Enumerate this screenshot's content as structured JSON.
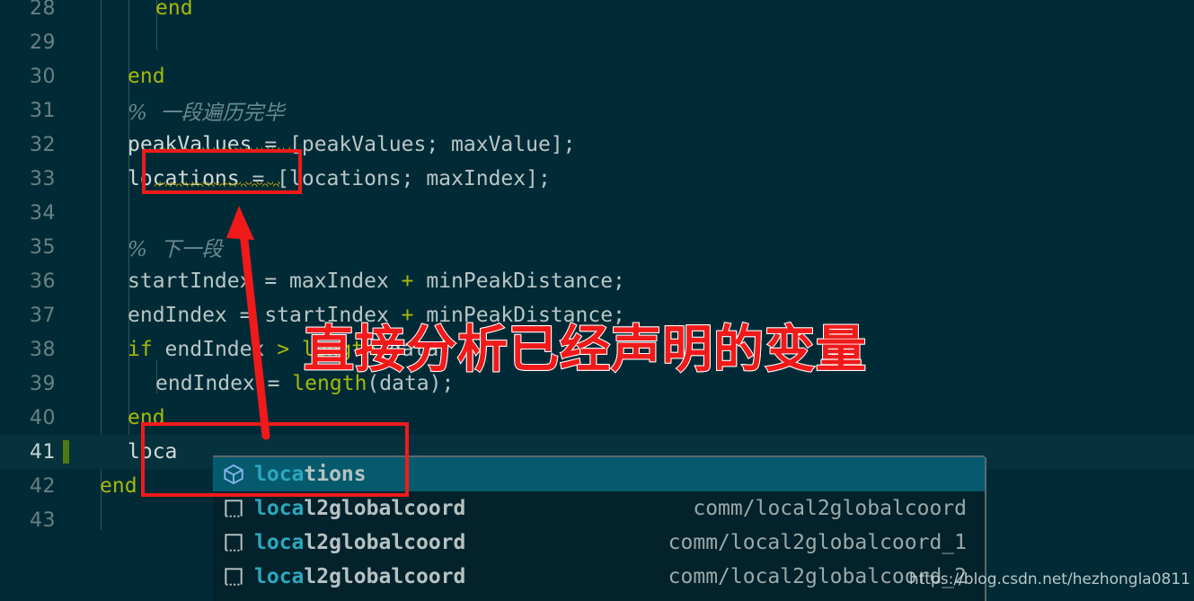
{
  "editor": {
    "background": "#002b36",
    "active_line_background": "#06323d",
    "first_visible_line": 28,
    "cursor_line": 41,
    "lines": [
      {
        "num": "28",
        "indent": 3,
        "tokens": [
          {
            "t": "end",
            "c": "kw"
          }
        ]
      },
      {
        "num": "29",
        "indent": 0,
        "tokens": []
      },
      {
        "num": "30",
        "indent": 2,
        "tokens": [
          {
            "t": "end",
            "c": "kw"
          }
        ]
      },
      {
        "num": "31",
        "indent": 2,
        "tokens": [
          {
            "t": "%  一段遍历完毕",
            "c": "cmt"
          }
        ]
      },
      {
        "num": "32",
        "indent": 2,
        "tokens": [
          {
            "t": "peakValues",
            "c": "id"
          },
          {
            "t": " = [peakValues; maxValue];",
            "c": "op"
          }
        ]
      },
      {
        "num": "33",
        "indent": 2,
        "tokens": [
          {
            "t": "locations",
            "c": "id"
          },
          {
            "t": " = [locations; maxIndex];",
            "c": "op"
          }
        ]
      },
      {
        "num": "34",
        "indent": 0,
        "tokens": []
      },
      {
        "num": "35",
        "indent": 2,
        "tokens": [
          {
            "t": "%  下一段",
            "c": "cmt"
          }
        ]
      },
      {
        "num": "36",
        "indent": 2,
        "tokens": [
          {
            "t": "startIndex = maxIndex ",
            "c": "op"
          },
          {
            "t": "+",
            "c": "opy"
          },
          {
            "t": " minPeakDistance;",
            "c": "op"
          }
        ]
      },
      {
        "num": "37",
        "indent": 2,
        "tokens": [
          {
            "t": "endIndex = startIndex ",
            "c": "op"
          },
          {
            "t": "+",
            "c": "opy"
          },
          {
            "t": " minPeakDistance;",
            "c": "op"
          }
        ]
      },
      {
        "num": "38",
        "indent": 2,
        "tokens": [
          {
            "t": "if",
            "c": "kw"
          },
          {
            "t": " endIndex ",
            "c": "op"
          },
          {
            "t": ">",
            "c": "opy"
          },
          {
            "t": " ",
            "c": "op"
          },
          {
            "t": "length",
            "c": "fn"
          },
          {
            "t": "(data)",
            "c": "op"
          }
        ]
      },
      {
        "num": "39",
        "indent": 3,
        "tokens": [
          {
            "t": "endIndex = ",
            "c": "op"
          },
          {
            "t": "length",
            "c": "fn"
          },
          {
            "t": "(data);",
            "c": "op"
          }
        ]
      },
      {
        "num": "40",
        "indent": 2,
        "tokens": [
          {
            "t": "end",
            "c": "kw"
          }
        ]
      },
      {
        "num": "41",
        "indent": 2,
        "tokens": [
          {
            "t": "loca",
            "c": "id"
          }
        ]
      },
      {
        "num": "42",
        "indent": 1,
        "tokens": [
          {
            "t": "end",
            "c": "kw"
          }
        ]
      },
      {
        "num": "43",
        "indent": 0,
        "tokens": []
      }
    ]
  },
  "suggest": {
    "items": [
      {
        "label_match": "loca",
        "label_rest": "tions",
        "detail": "",
        "icon": "variable-cube-icon",
        "selected": true
      },
      {
        "label_match": "loca",
        "label_rest": "l2globalcoord",
        "detail": "comm/local2globalcoord",
        "icon": "unit-file-icon",
        "selected": false
      },
      {
        "label_match": "loca",
        "label_rest": "l2globalcoord",
        "detail": "comm/local2globalcoord_1",
        "icon": "unit-file-icon",
        "selected": false
      },
      {
        "label_match": "loca",
        "label_rest": "l2globalcoord",
        "detail": "comm/local2globalcoord_2",
        "icon": "unit-file-icon",
        "selected": false
      }
    ]
  },
  "annotation": {
    "callout_text": "直接分析已经声明的变量",
    "callout_color": "#f01a1a",
    "arrow_name": "red-arrow-pointing-to-locations"
  },
  "watermark": {
    "text": "https://blog.csdn.net/hezhongla0811"
  }
}
